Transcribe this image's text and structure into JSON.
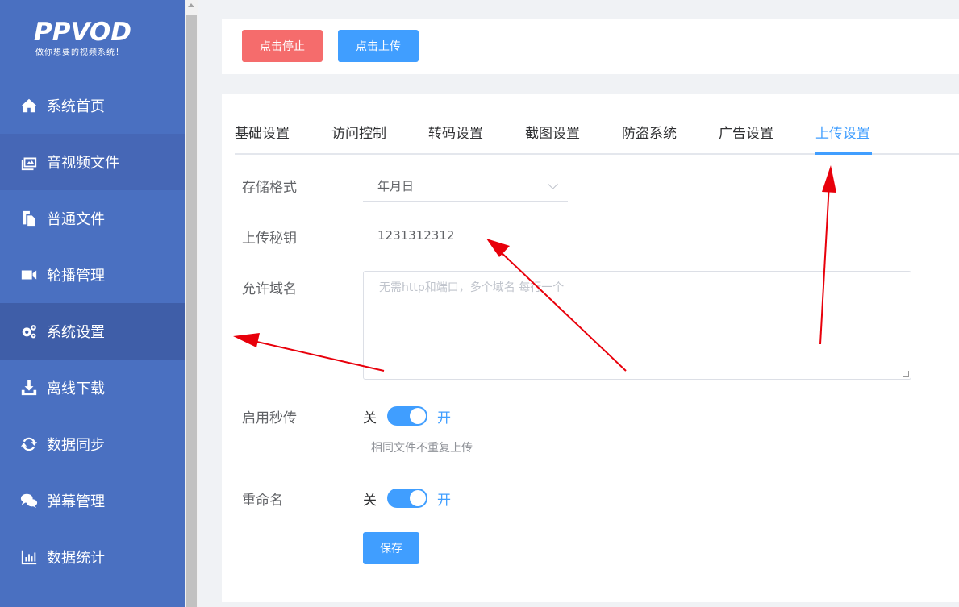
{
  "logo": {
    "text": "PPVOD",
    "tagline": "做你想要的视频系统！"
  },
  "sidebar": {
    "items": [
      {
        "label": "系统首页",
        "icon": "home-icon"
      },
      {
        "label": "音视频文件",
        "icon": "media-icon"
      },
      {
        "label": "普通文件",
        "icon": "files-icon"
      },
      {
        "label": "轮播管理",
        "icon": "video-camera-icon"
      },
      {
        "label": "系统设置",
        "icon": "gears-icon"
      },
      {
        "label": "离线下载",
        "icon": "download-icon"
      },
      {
        "label": "数据同步",
        "icon": "sync-icon"
      },
      {
        "label": "弹幕管理",
        "icon": "comments-icon"
      },
      {
        "label": "数据统计",
        "icon": "bar-chart-icon"
      }
    ]
  },
  "toolbar": {
    "stop_label": "点击停止",
    "upload_label": "点击上传"
  },
  "tabs": [
    "基础设置",
    "访问控制",
    "转码设置",
    "截图设置",
    "防盗系统",
    "广告设置",
    "上传设置"
  ],
  "active_tab": "上传设置",
  "form": {
    "storage_format": {
      "label": "存储格式",
      "value": "年月日"
    },
    "upload_key": {
      "label": "上传秘钥",
      "value": "1231312312"
    },
    "allowed_domains": {
      "label": "允许域名",
      "placeholder": "无需http和端口，多个域名 每行一个"
    },
    "instant_upload": {
      "label": "启用秒传",
      "off": "关",
      "on": "开",
      "enabled": true,
      "hint": "相同文件不重复上传"
    },
    "rename": {
      "label": "重命名",
      "off": "关",
      "on": "开",
      "enabled": true
    },
    "save_label": "保存"
  },
  "colors": {
    "sidebar": "#4a70c1",
    "primary": "#409eff",
    "danger": "#f56c6c",
    "annotation": "#e8000b"
  }
}
